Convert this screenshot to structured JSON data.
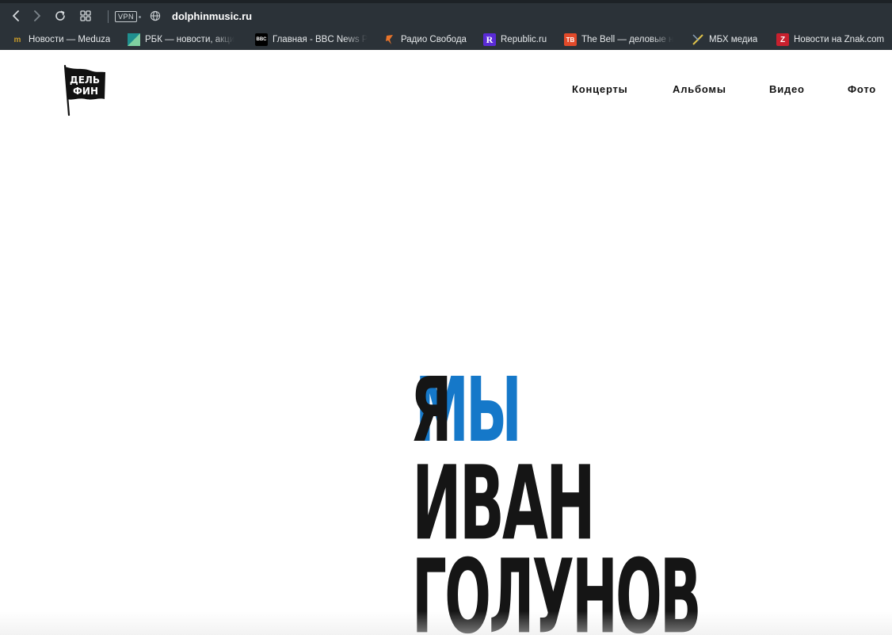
{
  "browser": {
    "url": "dolphinmusic.ru",
    "vpn_label": "VPN",
    "bookmarks": [
      {
        "label": "Новости — Meduza",
        "icon_text": "m",
        "icon_color": "#c89b2a",
        "icon_bg": "#2b3238"
      },
      {
        "label": "РБК — новости, акци",
        "icon_text": "",
        "icon_color": "#2fb37a",
        "icon_bg": "#1f8f8f"
      },
      {
        "label": "Главная - BBC News Р",
        "icon_text": "BBC",
        "icon_color": "#ffffff",
        "icon_bg": "#000000"
      },
      {
        "label": "Радио Свобода",
        "icon_text": "",
        "icon_color": "#e8742a",
        "icon_bg": "#2b3238"
      },
      {
        "label": "Republic.ru",
        "icon_text": "R",
        "icon_color": "#ffffff",
        "icon_bg": "#5a2bd6"
      },
      {
        "label": "The Bell — деловые н",
        "icon_text": "TB",
        "icon_color": "#ffffff",
        "icon_bg": "#e24a2a"
      },
      {
        "label": "МБХ медиа",
        "icon_text": "",
        "icon_color": "#e0c24a",
        "icon_bg": "#2b3238"
      },
      {
        "label": "Новости на Znak.com",
        "icon_text": "Z",
        "icon_color": "#ffffff",
        "icon_bg": "#c8202e"
      }
    ]
  },
  "site": {
    "logo_text_top": "ДЕЛЬ",
    "logo_text_bottom": "ФИН",
    "nav": [
      "Концерты",
      "Альбомы",
      "Видео",
      "Фото"
    ],
    "hero": {
      "line1_ya": "Я",
      "line1_my": "МЫ",
      "line2": "ИВАН",
      "line3": "ГОЛУНОВ"
    },
    "colors": {
      "accent_blue": "#1578c9",
      "text_dark": "#151515"
    }
  }
}
